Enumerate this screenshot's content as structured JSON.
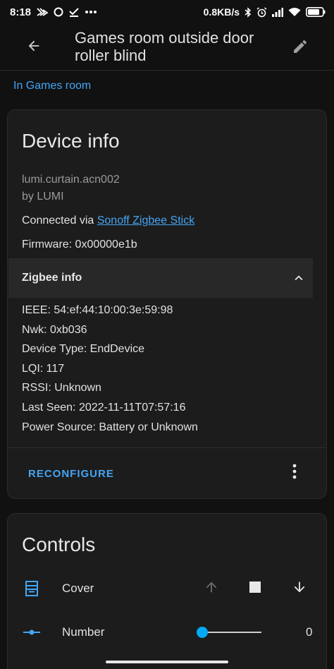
{
  "status_bar": {
    "time": "8:18",
    "net_speed": "0.8KB/s",
    "battery_level": 0.8,
    "icons": [
      "notification-icon",
      "circle-icon",
      "check-icon",
      "more-dots-icon",
      "bluetooth-icon",
      "alarm-icon",
      "signal-icon",
      "wifi-icon",
      "battery-icon"
    ]
  },
  "app_bar": {
    "title": "Games room outside door roller blind",
    "icons": [
      "arrow-left-icon",
      "pencil-icon"
    ]
  },
  "area_link": "In Games room",
  "device_info": {
    "title": "Device info",
    "model": "lumi.curtain.acn002",
    "manufacturer": "by LUMI",
    "connected_prefix": "Connected via ",
    "connected_link": "Sonoff Zigbee Stick",
    "firmware": "Firmware: 0x00000e1b",
    "zigbee_header": "Zigbee info",
    "zigbee_expanded": true,
    "zigbee": {
      "ieee": "IEEE: 54:ef:44:10:00:3e:59:98",
      "nwk": "Nwk: 0xb036",
      "device_type": "Device Type: EndDevice",
      "lqi": "LQI: 117",
      "rssi": "RSSI: Unknown",
      "last_seen": "Last Seen: 2022-11-11T07:57:16",
      "power_source": "Power Source: Battery or Unknown"
    },
    "reconfigure_label": "RECONFIGURE"
  },
  "controls": {
    "title": "Controls",
    "cover_label": "Cover",
    "number_label": "Number",
    "number_value": "0",
    "slider_fraction": 0
  },
  "colors": {
    "accent": "#43a5f5",
    "slider": "#03a9f4",
    "background": "#111111",
    "card": "#1c1c1c"
  }
}
